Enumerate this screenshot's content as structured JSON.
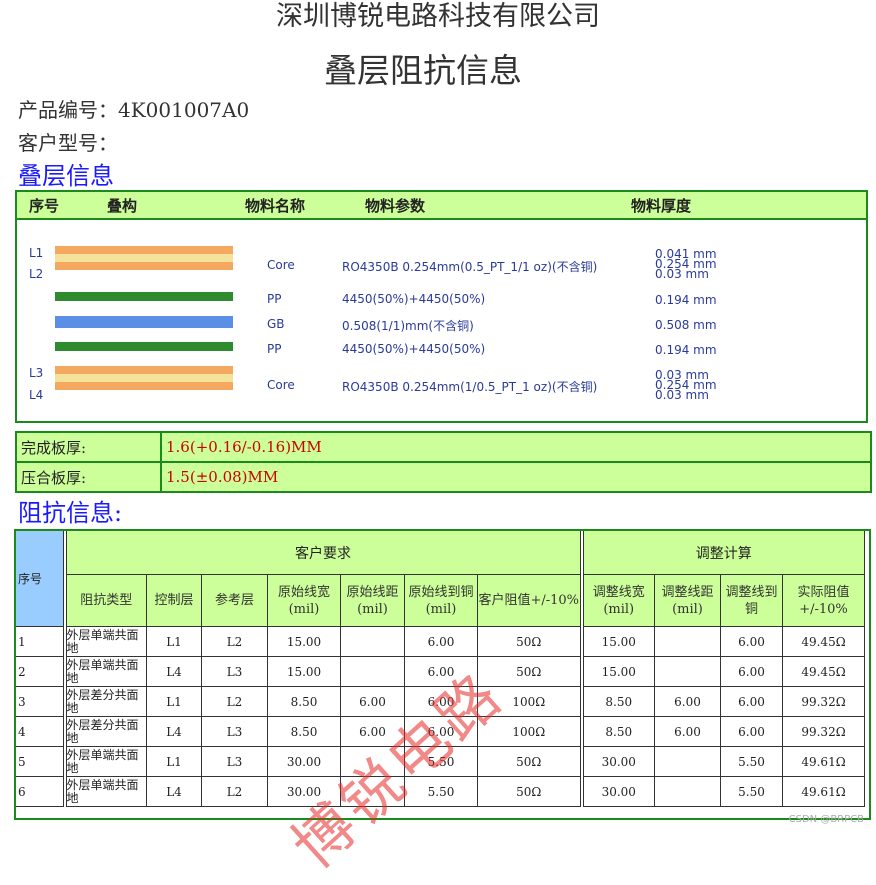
{
  "company": "深圳博锐电路科技有限公司",
  "doc_title": "叠层阻抗信息",
  "product_no_label": "产品编号：",
  "product_no": "4K001007A0",
  "customer_model_label": "客户型号：",
  "stack_section_title": "叠层信息",
  "stack_headers": {
    "index": "序号",
    "structure": "叠构",
    "material_name": "物料名称",
    "material_param": "物料参数",
    "material_thickness": "物料厚度"
  },
  "layer_names": {
    "l1": "L1",
    "l2": "L2",
    "l3": "L3",
    "l4": "L4"
  },
  "stack_rows": [
    {
      "material": "Core",
      "param": "RO4350B 0.254mm(0.5_PT_1/1 oz)(不含铜)",
      "thickness": [
        "0.041 mm",
        "0.254 mm",
        "0.03 mm"
      ]
    },
    {
      "material": "PP",
      "param": "4450(50%)+4450(50%)",
      "thickness": [
        "0.194 mm"
      ]
    },
    {
      "material": "GB",
      "param": "0.508(1/1)mm(不含铜)",
      "thickness": [
        "0.508 mm"
      ]
    },
    {
      "material": "PP",
      "param": "4450(50%)+4450(50%)",
      "thickness": [
        "0.194 mm"
      ]
    },
    {
      "material": "Core",
      "param": "RO4350B 0.254mm(1/0.5_PT_1 oz)(不含铜)",
      "thickness": [
        "0.03 mm",
        "0.254 mm",
        "0.03 mm"
      ]
    }
  ],
  "board_thickness": {
    "finished_label": "完成板厚:",
    "finished_value": "1.6(+0.16/-0.16)MM",
    "pressed_label": "压合板厚:",
    "pressed_value": "1.5(±0.08)MM"
  },
  "impedance_section_title": "阻抗信息:",
  "impedance": {
    "index_header": "序号",
    "customer_group": "客户要求",
    "adjust_group": "调整计算",
    "headers": [
      "阻抗类型",
      "控制层",
      "参考层",
      "原始线宽(mil)",
      "原始线距(mil)",
      "原始线到铜(mil)",
      "客户阻值+/-10%",
      "调整线宽(mil)",
      "调整线距(mil)",
      "调整线到铜",
      "实际阻值+/-10%"
    ],
    "rows": [
      {
        "n": "1",
        "type": "外层单端共面地",
        "ctrl": "L1",
        "ref": "L2",
        "w": "15.00",
        "s": "",
        "c": "6.00",
        "z": "50Ω",
        "aw": "15.00",
        "as": "",
        "ac": "6.00",
        "az": "49.45Ω"
      },
      {
        "n": "2",
        "type": "外层单端共面地",
        "ctrl": "L4",
        "ref": "L3",
        "w": "15.00",
        "s": "",
        "c": "6.00",
        "z": "50Ω",
        "aw": "15.00",
        "as": "",
        "ac": "6.00",
        "az": "49.45Ω"
      },
      {
        "n": "3",
        "type": "外层差分共面地",
        "ctrl": "L1",
        "ref": "L2",
        "w": "8.50",
        "s": "6.00",
        "c": "6.00",
        "z": "100Ω",
        "aw": "8.50",
        "as": "6.00",
        "ac": "6.00",
        "az": "99.32Ω"
      },
      {
        "n": "4",
        "type": "外层差分共面地",
        "ctrl": "L4",
        "ref": "L3",
        "w": "8.50",
        "s": "6.00",
        "c": "6.00",
        "z": "100Ω",
        "aw": "8.50",
        "as": "6.00",
        "ac": "6.00",
        "az": "99.32Ω"
      },
      {
        "n": "5",
        "type": "外层单端共面地",
        "ctrl": "L1",
        "ref": "L3",
        "w": "30.00",
        "s": "",
        "c": "5.50",
        "z": "50Ω",
        "aw": "30.00",
        "as": "",
        "ac": "5.50",
        "az": "49.61Ω"
      },
      {
        "n": "6",
        "type": "外层单端共面地",
        "ctrl": "L4",
        "ref": "L2",
        "w": "30.00",
        "s": "",
        "c": "5.50",
        "z": "50Ω",
        "aw": "30.00",
        "as": "",
        "ac": "5.50",
        "az": "49.61Ω"
      }
    ]
  },
  "watermark": "博锐电路",
  "csdn_mark": "CSDN @BRPCB",
  "colors": {
    "green_fill": "#ccff99",
    "border_green": "#1a8a1a",
    "blue_heading": "#1a1aff",
    "red_value": "#cc0000",
    "copper": "#f4a860",
    "prepreg_light": "#f5e29b",
    "pp_green": "#2e8b2e",
    "gb_blue": "#5b8fe6"
  }
}
